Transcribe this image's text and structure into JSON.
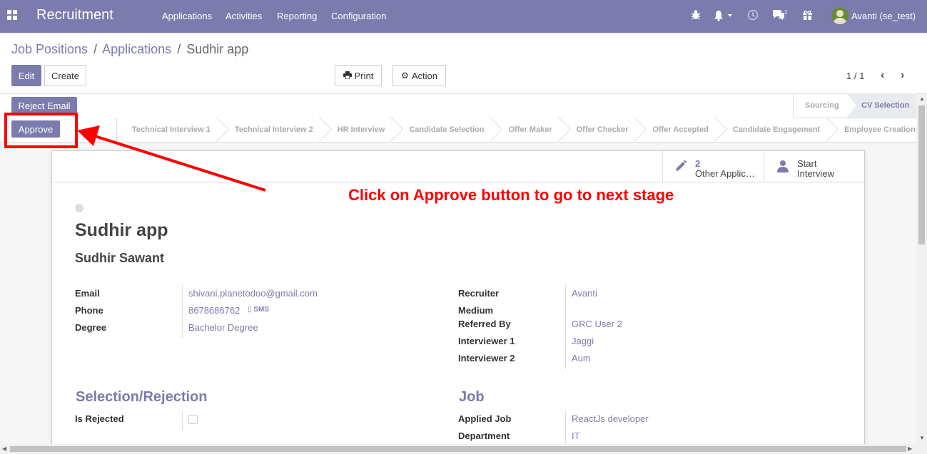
{
  "navbar": {
    "app_title": "Recruitment",
    "menu": [
      "Applications",
      "Activities",
      "Reporting",
      "Configuration"
    ],
    "chat_count": "1",
    "user": "Avanti (se_test)"
  },
  "breadcrumb": {
    "items": [
      "Job Positions",
      "Applications",
      "Sudhir app"
    ],
    "separator": "/"
  },
  "toolbar": {
    "edit_label": "Edit",
    "create_label": "Create",
    "print_label": "Print",
    "action_label": "Action",
    "pager": "1 / 1"
  },
  "statusbar": {
    "reject_email_label": "Reject Email",
    "approve_label": "Approve",
    "stages_top": [
      "Sourcing",
      "CV Selection"
    ],
    "active_stage": "CV Selection",
    "stages": [
      "Technical Interview 1",
      "Technical Interview 2",
      "HR Interview",
      "Candidate Selection",
      "Offer Maker",
      "Offer Checker",
      "Offer Accepted",
      "Candidate Engagement",
      "Employee Creation"
    ]
  },
  "smart_buttons": {
    "applications_count": "2",
    "applications_label": "Other Applic…",
    "start_label": "Start",
    "interview_label": "Interview"
  },
  "form": {
    "title": "Sudhir app",
    "applicant_name": "Sudhir Sawant",
    "left_fields": {
      "email_label": "Email",
      "email_value": "shivani.planetodoo@gmail.com",
      "phone_label": "Phone",
      "phone_value": "8678686762",
      "sms_label": "SMS",
      "degree_label": "Degree",
      "degree_value": "Bachelor Degree"
    },
    "right_fields": {
      "recruiter_label": "Recruiter",
      "recruiter_value": "Avanti",
      "medium_label": "Medium",
      "referred_label": "Referred By",
      "referred_value": "GRC User 2",
      "interviewer1_label": "Interviewer 1",
      "interviewer1_value": "Jaggi",
      "interviewer2_label": "Interviewer 2",
      "interviewer2_value": "Aum"
    },
    "selection_section": "Selection/Rejection",
    "is_rejected_label": "Is Rejected",
    "is_rejected": false,
    "job_section": "Job",
    "applied_job_label": "Applied Job",
    "applied_job_value": "ReactJs developer",
    "department_label": "Department",
    "department_value": "IT"
  },
  "annotation": {
    "text": "Click on Approve button to go to next stage",
    "color": "#ff0000"
  },
  "colors": {
    "brand": "#7c7bad",
    "annotation": "#ff0000"
  }
}
